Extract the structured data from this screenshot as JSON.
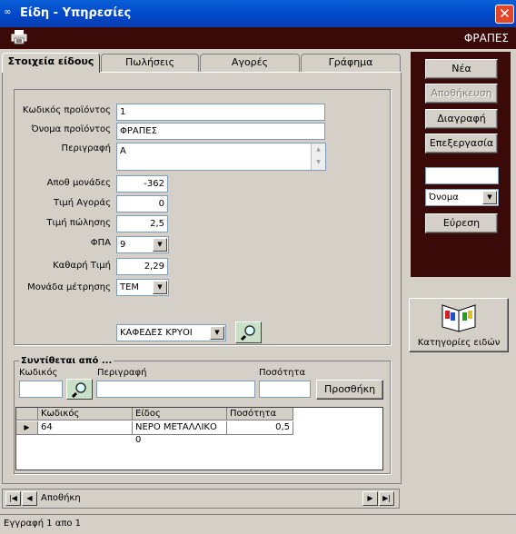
{
  "window": {
    "title": "Είδη - Υπηρεσίες",
    "close_glyph": "✕"
  },
  "header": {
    "title": "ΦΡΑΠΕΣ"
  },
  "tabs": [
    {
      "label": "Στοιχεία είδους"
    },
    {
      "label": "Πωλήσεις"
    },
    {
      "label": "Αγορές"
    },
    {
      "label": "Γράφημα"
    }
  ],
  "form": {
    "code_label": "Κωδικός προϊόντος",
    "code_value": "1",
    "name_label": "Όνομα προϊόντος",
    "name_value": "ΦΡΑΠΕΣ",
    "desc_label": "Περιγραφή",
    "desc_value": "Α",
    "stock_label": "Αποθ μονάδες",
    "stock_value": "-362",
    "buy_label": "Τιμή Αγοράς",
    "buy_value": "0",
    "sell_label": "Τιμή πώλησης",
    "sell_value": "2,5",
    "vat_label": "ΦΠΑ",
    "vat_value": "9",
    "net_label": "Καθαρή Τιμή",
    "net_value": "2,29",
    "unit_label": "Μονάδα μέτρησης",
    "unit_value": "ΤΕΜ",
    "category_value": "ΚΑΦΕΔΕΣ ΚΡΥΟΙ"
  },
  "composed": {
    "title": "Συντίθεται από ...",
    "code_label": "Κωδικός",
    "desc_label": "Περιγραφή",
    "qty_label": "Ποσότητα",
    "add_button": "Προσθήκη",
    "columns": [
      "Κωδικός",
      "Είδος",
      "Ποσότητα"
    ],
    "rows": [
      {
        "code": "64",
        "item": "ΝΕΡΟ ΜΕΤΑΛΛΙΚΟ 0",
        "qty": "0,5"
      }
    ]
  },
  "actions": {
    "new": "Νέα",
    "save": "Αποθήκευση",
    "delete": "Διαγραφή",
    "edit": "Επεξεργασία",
    "search_field_value": "Όνομα",
    "find": "Εύρεση",
    "categories": "Κατηγορίες ειδών"
  },
  "navigator": {
    "caption": "Αποθήκη"
  },
  "status": {
    "text": "Εγγραφή 1 απο 1"
  },
  "colors": {
    "header_bg": "#3a0a09",
    "titlebar": "#0046c8",
    "close": "#e1462a"
  }
}
